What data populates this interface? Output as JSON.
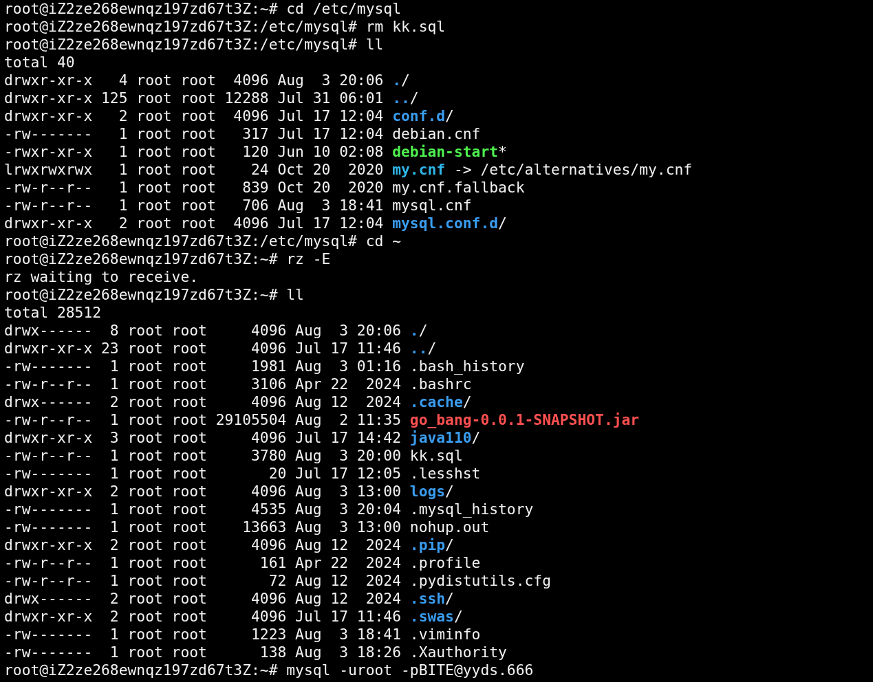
{
  "terminal": {
    "lines": [
      {
        "segments": [
          {
            "kind": "plain",
            "text": "root@iZ2ze268ewnqz197zd67t3Z:~# cd /etc/mysql"
          }
        ]
      },
      {
        "segments": [
          {
            "kind": "plain",
            "text": "root@iZ2ze268ewnqz197zd67t3Z:/etc/mysql# rm kk.sql"
          }
        ]
      },
      {
        "segments": [
          {
            "kind": "plain",
            "text": "root@iZ2ze268ewnqz197zd67t3Z:/etc/mysql# ll"
          }
        ]
      },
      {
        "segments": [
          {
            "kind": "plain",
            "text": "total 40"
          }
        ]
      },
      {
        "segments": [
          {
            "kind": "plain",
            "text": "drwxr-xr-x   4 root root  4096 Aug  3 20:06 "
          },
          {
            "kind": "dir",
            "text": "."
          },
          {
            "kind": "plain",
            "text": "/"
          }
        ]
      },
      {
        "segments": [
          {
            "kind": "plain",
            "text": "drwxr-xr-x 125 root root 12288 Jul 31 06:01 "
          },
          {
            "kind": "dir",
            "text": ".."
          },
          {
            "kind": "plain",
            "text": "/"
          }
        ]
      },
      {
        "segments": [
          {
            "kind": "plain",
            "text": "drwxr-xr-x   2 root root  4096 Jul 17 12:04 "
          },
          {
            "kind": "dir",
            "text": "conf.d"
          },
          {
            "kind": "plain",
            "text": "/"
          }
        ]
      },
      {
        "segments": [
          {
            "kind": "plain",
            "text": "-rw-------   1 root root   317 Jul 17 12:04 debian.cnf"
          }
        ]
      },
      {
        "segments": [
          {
            "kind": "plain",
            "text": "-rwxr-xr-x   1 root root   120 Jun 10 02:08 "
          },
          {
            "kind": "exec",
            "text": "debian-start"
          },
          {
            "kind": "plain",
            "text": "*"
          }
        ]
      },
      {
        "segments": [
          {
            "kind": "plain",
            "text": "lrwxrwxrwx   1 root root    24 Oct 20  2020 "
          },
          {
            "kind": "link",
            "text": "my.cnf"
          },
          {
            "kind": "plain",
            "text": " -> /etc/alternatives/my.cnf"
          }
        ]
      },
      {
        "segments": [
          {
            "kind": "plain",
            "text": "-rw-r--r--   1 root root   839 Oct 20  2020 my.cnf.fallback"
          }
        ]
      },
      {
        "segments": [
          {
            "kind": "plain",
            "text": "-rw-r--r--   1 root root   706 Aug  3 18:41 mysql.cnf"
          }
        ]
      },
      {
        "segments": [
          {
            "kind": "plain",
            "text": "drwxr-xr-x   2 root root  4096 Jul 17 12:04 "
          },
          {
            "kind": "dir",
            "text": "mysql.conf.d"
          },
          {
            "kind": "plain",
            "text": "/"
          }
        ]
      },
      {
        "segments": [
          {
            "kind": "plain",
            "text": "root@iZ2ze268ewnqz197zd67t3Z:/etc/mysql# cd ~"
          }
        ]
      },
      {
        "segments": [
          {
            "kind": "plain",
            "text": "root@iZ2ze268ewnqz197zd67t3Z:~# rz -E"
          }
        ]
      },
      {
        "segments": [
          {
            "kind": "plain",
            "text": "rz waiting to receive."
          }
        ]
      },
      {
        "segments": [
          {
            "kind": "plain",
            "text": "root@iZ2ze268ewnqz197zd67t3Z:~# ll"
          }
        ]
      },
      {
        "segments": [
          {
            "kind": "plain",
            "text": "total 28512"
          }
        ]
      },
      {
        "segments": [
          {
            "kind": "plain",
            "text": "drwx------  8 root root     4096 Aug  3 20:06 "
          },
          {
            "kind": "dir",
            "text": "."
          },
          {
            "kind": "plain",
            "text": "/"
          }
        ]
      },
      {
        "segments": [
          {
            "kind": "plain",
            "text": "drwxr-xr-x 23 root root     4096 Jul 17 11:46 "
          },
          {
            "kind": "dir",
            "text": ".."
          },
          {
            "kind": "plain",
            "text": "/"
          }
        ]
      },
      {
        "segments": [
          {
            "kind": "plain",
            "text": "-rw-------  1 root root     1981 Aug  3 01:16 .bash_history"
          }
        ]
      },
      {
        "segments": [
          {
            "kind": "plain",
            "text": "-rw-r--r--  1 root root     3106 Apr 22  2024 .bashrc"
          }
        ]
      },
      {
        "segments": [
          {
            "kind": "plain",
            "text": "drwx------  2 root root     4096 Aug 12  2024 "
          },
          {
            "kind": "dir",
            "text": ".cache"
          },
          {
            "kind": "plain",
            "text": "/"
          }
        ]
      },
      {
        "segments": [
          {
            "kind": "plain",
            "text": "-rw-r--r--  1 root root 29105504 Aug  2 11:35 "
          },
          {
            "kind": "archive",
            "text": "go_bang-0.0.1-SNAPSHOT.jar"
          }
        ]
      },
      {
        "segments": [
          {
            "kind": "plain",
            "text": "drwxr-xr-x  3 root root     4096 Jul 17 14:42 "
          },
          {
            "kind": "dir",
            "text": "java110"
          },
          {
            "kind": "plain",
            "text": "/"
          }
        ]
      },
      {
        "segments": [
          {
            "kind": "plain",
            "text": "-rw-r--r--  1 root root     3780 Aug  3 20:00 kk.sql"
          }
        ]
      },
      {
        "segments": [
          {
            "kind": "plain",
            "text": "-rw-------  1 root root       20 Jul 17 12:05 .lesshst"
          }
        ]
      },
      {
        "segments": [
          {
            "kind": "plain",
            "text": "drwxr-xr-x  2 root root     4096 Aug  3 13:00 "
          },
          {
            "kind": "dir",
            "text": "logs"
          },
          {
            "kind": "plain",
            "text": "/"
          }
        ]
      },
      {
        "segments": [
          {
            "kind": "plain",
            "text": "-rw-------  1 root root     4535 Aug  3 20:04 .mysql_history"
          }
        ]
      },
      {
        "segments": [
          {
            "kind": "plain",
            "text": "-rw-------  1 root root    13663 Aug  3 13:00 nohup.out"
          }
        ]
      },
      {
        "segments": [
          {
            "kind": "plain",
            "text": "drwxr-xr-x  2 root root     4096 Aug 12  2024 "
          },
          {
            "kind": "dir",
            "text": ".pip"
          },
          {
            "kind": "plain",
            "text": "/"
          }
        ]
      },
      {
        "segments": [
          {
            "kind": "plain",
            "text": "-rw-r--r--  1 root root      161 Apr 22  2024 .profile"
          }
        ]
      },
      {
        "segments": [
          {
            "kind": "plain",
            "text": "-rw-r--r--  1 root root       72 Aug 12  2024 .pydistutils.cfg"
          }
        ]
      },
      {
        "segments": [
          {
            "kind": "plain",
            "text": "drwx------  2 root root     4096 Aug 12  2024 "
          },
          {
            "kind": "dir",
            "text": ".ssh"
          },
          {
            "kind": "plain",
            "text": "/"
          }
        ]
      },
      {
        "segments": [
          {
            "kind": "plain",
            "text": "drwxr-xr-x  2 root root     4096 Jul 17 11:46 "
          },
          {
            "kind": "dir",
            "text": ".swas"
          },
          {
            "kind": "plain",
            "text": "/"
          }
        ]
      },
      {
        "segments": [
          {
            "kind": "plain",
            "text": "-rw-------  1 root root     1223 Aug  3 18:41 .viminfo"
          }
        ]
      },
      {
        "segments": [
          {
            "kind": "plain",
            "text": "-rw-------  1 root root      138 Aug  3 18:26 .Xauthority"
          }
        ]
      },
      {
        "segments": [
          {
            "kind": "plain",
            "text": "root@iZ2ze268ewnqz197zd67t3Z:~# mysql -uroot -pBITE@yyds.666"
          }
        ]
      }
    ]
  }
}
